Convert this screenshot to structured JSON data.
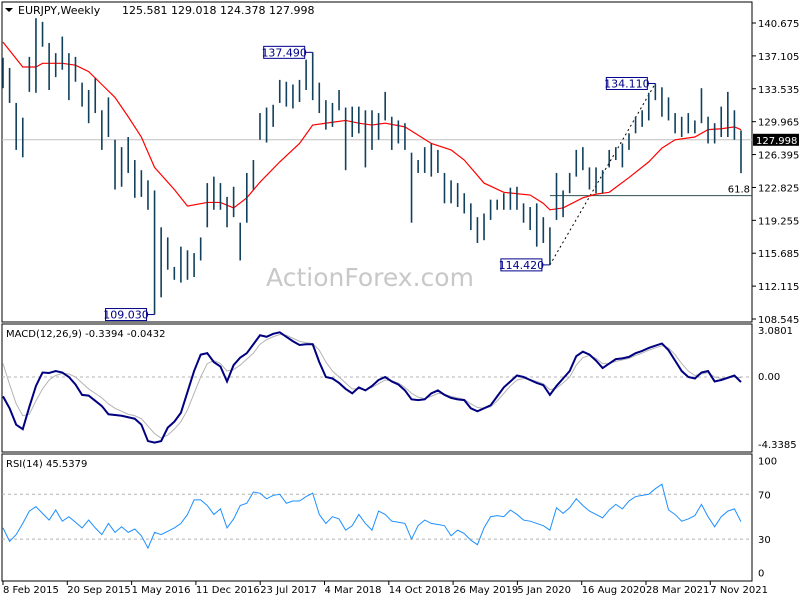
{
  "header": {
    "symbol_timeframe": "EURJPY,Weekly",
    "ohlc": "125.581 129.018 124.378 127.998"
  },
  "watermark": "ActionForex.com",
  "colors": {
    "bars": "#10405c",
    "moving_average": "#ff0000",
    "macd_main": "#000080",
    "macd_signal": "#b4b4b4",
    "rsi": "#1e90ff",
    "current_price_bg": "#000000",
    "annotation_border": "#00008b",
    "grid_level": "#b4b4b4"
  },
  "chart_data": [
    {
      "type": "ohlc-bar",
      "title": "EURJPY,Weekly",
      "ylim": [
        108.545,
        140.675
      ],
      "y_ticks": [
        "140.675",
        "137.105",
        "133.535",
        "129.965",
        "126.395",
        "122.825",
        "119.255",
        "115.685",
        "112.115",
        "108.545"
      ],
      "x_ticks": [
        "8 Feb 2015",
        "20 Sep 2015",
        "1 May 2016",
        "11 Dec 2016",
        "23 Jul 2017",
        "4 Mar 2018",
        "14 Oct 2018",
        "26 May 2019",
        "5 Jan 2020",
        "16 Aug 2020",
        "28 Mar 2021",
        "7 Nov 2021"
      ],
      "current_price": "127.998",
      "bars_high_low": [
        [
          136.9,
          133.6
        ],
        [
          135.8,
          132.0
        ],
        [
          132.0,
          126.9
        ],
        [
          130.4,
          126.1
        ],
        [
          137.0,
          133.2
        ],
        [
          141.2,
          133.1
        ],
        [
          140.8,
          138.1
        ],
        [
          138.5,
          133.4
        ],
        [
          137.4,
          134.8
        ],
        [
          139.2,
          135.6
        ],
        [
          137.4,
          132.3
        ],
        [
          137.0,
          134.3
        ],
        [
          134.2,
          131.6
        ],
        [
          133.4,
          129.8
        ],
        [
          134.7,
          130.9
        ],
        [
          131.2,
          126.9
        ],
        [
          132.6,
          128.3
        ],
        [
          128.0,
          122.6
        ],
        [
          127.2,
          122.9
        ],
        [
          128.3,
          124.4
        ],
        [
          125.8,
          121.7
        ],
        [
          124.7,
          121.8
        ],
        [
          123.6,
          120.4
        ],
        [
          122.5,
          109.03
        ],
        [
          118.5,
          110.9
        ],
        [
          117.4,
          113.9
        ],
        [
          114.2,
          112.8
        ],
        [
          116.4,
          112.5
        ],
        [
          116.0,
          112.8
        ],
        [
          115.7,
          113.1
        ],
        [
          117.4,
          114.9
        ],
        [
          123.3,
          118.5
        ],
        [
          124.0,
          120.4
        ],
        [
          123.3,
          120.4
        ],
        [
          121.8,
          118.5
        ],
        [
          122.9,
          119.6
        ],
        [
          119.0,
          114.9
        ],
        [
          124.4,
          119.0
        ],
        [
          125.8,
          122.6
        ],
        [
          130.9,
          128.0
        ],
        [
          131.5,
          127.7
        ],
        [
          131.8,
          129.4
        ],
        [
          134.5,
          132.0
        ],
        [
          134.3,
          131.6
        ],
        [
          134.0,
          131.4
        ],
        [
          134.5,
          132.1
        ],
        [
          136.7,
          133.4
        ],
        [
          137.49,
          132.3
        ],
        [
          134.2,
          130.9
        ],
        [
          132.3,
          129.1
        ],
        [
          132.0,
          129.4
        ],
        [
          133.4,
          131.2
        ],
        [
          131.5,
          124.7
        ],
        [
          131.6,
          128.3
        ],
        [
          131.6,
          128.7
        ],
        [
          131.2,
          125.0
        ],
        [
          131.2,
          126.9
        ],
        [
          130.9,
          128.0
        ],
        [
          133.2,
          130.1
        ],
        [
          130.5,
          126.9
        ],
        [
          130.1,
          127.6
        ],
        [
          129.8,
          126.9
        ],
        [
          126.6,
          119.0
        ],
        [
          125.8,
          124.4
        ],
        [
          127.2,
          124.4
        ],
        [
          127.6,
          124.0
        ],
        [
          126.9,
          124.4
        ],
        [
          124.4,
          121.1
        ],
        [
          123.6,
          121.1
        ],
        [
          123.3,
          120.7
        ],
        [
          122.2,
          120.0
        ],
        [
          121.1,
          118.2
        ],
        [
          119.6,
          116.8
        ],
        [
          120.0,
          117.1
        ],
        [
          121.5,
          119.3
        ],
        [
          121.5,
          120.4
        ],
        [
          122.2,
          120.4
        ],
        [
          122.8,
          120.4
        ],
        [
          122.9,
          120.4
        ],
        [
          121.1,
          119.0
        ],
        [
          120.7,
          118.2
        ],
        [
          121.1,
          116.4
        ],
        [
          119.6,
          116.8
        ],
        [
          118.5,
          114.42
        ],
        [
          124.4,
          119.3
        ],
        [
          122.5,
          119.6
        ],
        [
          124.4,
          122.2
        ],
        [
          126.9,
          124.0
        ],
        [
          127.2,
          124.7
        ],
        [
          125.0,
          122.6
        ],
        [
          125.0,
          122.2
        ],
        [
          124.7,
          122.2
        ],
        [
          126.9,
          125.0
        ],
        [
          127.2,
          125.8
        ],
        [
          127.6,
          125.0
        ],
        [
          128.7,
          126.9
        ],
        [
          130.5,
          128.7
        ],
        [
          131.2,
          129.4
        ],
        [
          133.1,
          130.1
        ],
        [
          134.11,
          132.3
        ],
        [
          133.7,
          130.5
        ],
        [
          132.6,
          130.1
        ],
        [
          130.9,
          128.7
        ],
        [
          130.5,
          128.3
        ],
        [
          130.9,
          128.7
        ],
        [
          130.1,
          128.7
        ],
        [
          133.6,
          129.8
        ],
        [
          130.5,
          127.6
        ],
        [
          129.8,
          127.6
        ],
        [
          131.6,
          128.3
        ],
        [
          133.2,
          128.3
        ],
        [
          131.2,
          128.0
        ],
        [
          129.018,
          124.378
        ]
      ],
      "moving_average_by_bar": [
        [
          0,
          138.6
        ],
        [
          3,
          135.9
        ],
        [
          5,
          135.9
        ],
        [
          6,
          136.3
        ],
        [
          9,
          136.3
        ],
        [
          11,
          136.1
        ],
        [
          13,
          135.4
        ],
        [
          15,
          134.0
        ],
        [
          17,
          132.6
        ],
        [
          19,
          130.5
        ],
        [
          21,
          128.3
        ],
        [
          23,
          125.0
        ],
        [
          26,
          122.6
        ],
        [
          28,
          120.8
        ],
        [
          31,
          121.2
        ],
        [
          33,
          121.2
        ],
        [
          35,
          120.6
        ],
        [
          37,
          121.7
        ],
        [
          39,
          123.4
        ],
        [
          42,
          125.6
        ],
        [
          45,
          127.6
        ],
        [
          47,
          129.6
        ],
        [
          50,
          129.9
        ],
        [
          52,
          130.1
        ],
        [
          54,
          129.8
        ],
        [
          56,
          129.6
        ],
        [
          58,
          129.8
        ],
        [
          61,
          129.4
        ],
        [
          63,
          128.5
        ],
        [
          65,
          127.6
        ],
        [
          68,
          126.9
        ],
        [
          70,
          125.8
        ],
        [
          73,
          123.3
        ],
        [
          76,
          122.3
        ],
        [
          80,
          122.0
        ],
        [
          82,
          121.1
        ],
        [
          83,
          120.4
        ],
        [
          85,
          120.6
        ],
        [
          88,
          121.7
        ],
        [
          90,
          122.1
        ],
        [
          92,
          122.3
        ],
        [
          95,
          123.9
        ],
        [
          98,
          125.6
        ],
        [
          100,
          127.1
        ],
        [
          102,
          128.0
        ],
        [
          105,
          128.3
        ],
        [
          107,
          129.1
        ],
        [
          109,
          129.2
        ],
        [
          111,
          129.4
        ],
        [
          112,
          129.1
        ]
      ],
      "annotations": [
        {
          "text": "109.030",
          "value": 109.03,
          "kind": "low"
        },
        {
          "text": "137.490",
          "value": 137.49,
          "kind": "high"
        },
        {
          "text": "114.420",
          "value": 114.42,
          "kind": "low"
        },
        {
          "text": "134.110",
          "value": 134.11,
          "kind": "high"
        }
      ],
      "fibonacci": {
        "from": 114.42,
        "to": 134.11,
        "level_label": "61.8",
        "level_value": 121.94
      }
    },
    {
      "type": "line",
      "title": "MACD(12,26,9) -0.3394 -0.0432",
      "y_ticks": [
        "3.0801",
        "0.00",
        "-4.3385"
      ],
      "ylim": [
        -4.3385,
        3.0801
      ],
      "main": [
        -1.3,
        -2.1,
        -3.2,
        -3.5,
        -2.0,
        -0.6,
        0.3,
        0.27,
        0.4,
        0.3,
        0.0,
        -0.5,
        -1.2,
        -1.25,
        -1.6,
        -1.95,
        -2.5,
        -2.55,
        -2.6,
        -2.7,
        -2.8,
        -3.2,
        -4.3,
        -4.4,
        -4.3,
        -3.4,
        -3.0,
        -2.4,
        -1.0,
        0.4,
        1.5,
        1.6,
        1.0,
        0.7,
        -0.3,
        0.8,
        1.3,
        1.6,
        2.2,
        2.8,
        2.7,
        2.9,
        3.0,
        2.7,
        2.4,
        2.15,
        2.2,
        2.2,
        1.0,
        0.0,
        -0.1,
        -0.4,
        -0.8,
        -1.1,
        -0.7,
        -0.9,
        -0.6,
        -0.2,
        0.0,
        -0.3,
        -0.5,
        -0.9,
        -1.5,
        -1.55,
        -1.5,
        -1.1,
        -0.9,
        -1.2,
        -1.4,
        -1.5,
        -1.55,
        -2.1,
        -2.3,
        -2.1,
        -1.9,
        -1.3,
        -0.7,
        -0.3,
        0.1,
        0.0,
        -0.2,
        -0.4,
        -0.55,
        -1.2,
        -0.6,
        -0.1,
        0.4,
        1.4,
        1.7,
        1.5,
        1.1,
        0.6,
        0.9,
        1.2,
        1.25,
        1.35,
        1.6,
        1.75,
        1.95,
        2.1,
        2.25,
        1.8,
        1.1,
        0.4,
        0.0,
        -0.1,
        0.3,
        0.4,
        -0.3,
        -0.2,
        -0.05,
        0.1,
        -0.3394
      ],
      "signal": [
        0.9,
        -0.5,
        -1.8,
        -2.6,
        -2.5,
        -1.6,
        -0.8,
        -0.2,
        0.1,
        0.25,
        0.2,
        0.0,
        -0.4,
        -0.8,
        -1.1,
        -1.4,
        -1.8,
        -2.1,
        -2.3,
        -2.5,
        -2.6,
        -2.8,
        -3.3,
        -3.8,
        -4.1,
        -3.9,
        -3.5,
        -3.0,
        -2.2,
        -1.1,
        0.0,
        0.9,
        1.1,
        0.9,
        0.4,
        0.5,
        0.8,
        1.2,
        1.6,
        2.2,
        2.5,
        2.7,
        2.85,
        2.8,
        2.6,
        2.4,
        2.3,
        2.25,
        1.8,
        1.0,
        0.4,
        0.0,
        -0.4,
        -0.8,
        -0.8,
        -0.85,
        -0.7,
        -0.45,
        -0.2,
        -0.25,
        -0.4,
        -0.7,
        -1.1,
        -1.35,
        -1.45,
        -1.3,
        -1.1,
        -1.15,
        -1.3,
        -1.4,
        -1.5,
        -1.8,
        -2.05,
        -2.1,
        -2.0,
        -1.6,
        -1.1,
        -0.6,
        -0.2,
        -0.1,
        -0.15,
        -0.3,
        -0.45,
        -0.85,
        -0.75,
        -0.4,
        0.0,
        0.8,
        1.3,
        1.45,
        1.25,
        0.9,
        0.9,
        1.05,
        1.15,
        1.25,
        1.45,
        1.6,
        1.8,
        1.95,
        2.1,
        1.95,
        1.5,
        0.9,
        0.4,
        0.1,
        0.2,
        0.3,
        0.0,
        -0.1,
        -0.05,
        0.0,
        -0.0432
      ]
    },
    {
      "type": "line",
      "title": "RSI(14) 45.5379",
      "y_ticks": [
        "100",
        "70",
        "30",
        "0"
      ],
      "ylim": [
        0,
        100
      ],
      "levels": [
        70,
        30
      ],
      "values": [
        40,
        28,
        34,
        44,
        55,
        59,
        53,
        47,
        56,
        46,
        50,
        45,
        40,
        47,
        40,
        34,
        44,
        36,
        41,
        36,
        39,
        33,
        22,
        36,
        34,
        37,
        40,
        44,
        52,
        65,
        65,
        60,
        52,
        57,
        40,
        48,
        60,
        62,
        72,
        71,
        66,
        69,
        70,
        62,
        64,
        64,
        68,
        71,
        52,
        44,
        50,
        48,
        38,
        42,
        52,
        44,
        38,
        55,
        52,
        46,
        45,
        44,
        30,
        42,
        47,
        44,
        43,
        42,
        33,
        38,
        35,
        29,
        25,
        40,
        50,
        51,
        50,
        56,
        52,
        47,
        46,
        44,
        42,
        38,
        58,
        53,
        58,
        66,
        60,
        55,
        52,
        49,
        56,
        61,
        57,
        64,
        68,
        69,
        70,
        75,
        79,
        56,
        52,
        46,
        48,
        51,
        61,
        50,
        41,
        50,
        55,
        57,
        45.5379
      ]
    }
  ]
}
